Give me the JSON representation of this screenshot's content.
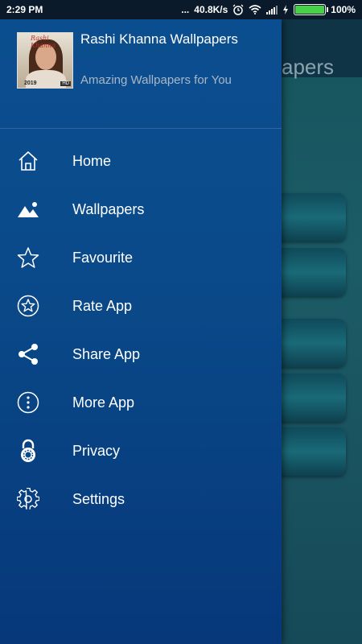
{
  "status_bar": {
    "time": "2:29 PM",
    "dots": "...",
    "speed": "40.8K/s",
    "battery": "100%",
    "icons": [
      "alarm-icon",
      "wifi-icon",
      "signal-icon",
      "charging-icon",
      "battery-icon"
    ]
  },
  "background": {
    "title_fragment": "apers"
  },
  "drawer": {
    "app_name": "Rashi Khanna Wallpapers",
    "tagline": "Amazing Wallpapers for You",
    "icon_caption": "Rashi Khanna",
    "icon_year": "2019",
    "icon_hd": "HD",
    "menu": [
      {
        "label": "Home",
        "icon": "home-icon"
      },
      {
        "label": "Wallpapers",
        "icon": "image-icon"
      },
      {
        "label": "Favourite",
        "icon": "star-icon"
      },
      {
        "label": "Rate App",
        "icon": "rate-star-icon"
      },
      {
        "label": "Share App",
        "icon": "share-icon"
      },
      {
        "label": "More App",
        "icon": "more-vertical-icon"
      },
      {
        "label": "Privacy",
        "icon": "lock-icon"
      },
      {
        "label": "Settings",
        "icon": "gear-icon"
      }
    ]
  },
  "colors": {
    "drawer_top": "#0b4e8f",
    "drawer_bottom": "#06387a",
    "battery_fill": "#46d246",
    "tagline": "#a9b8c8"
  }
}
